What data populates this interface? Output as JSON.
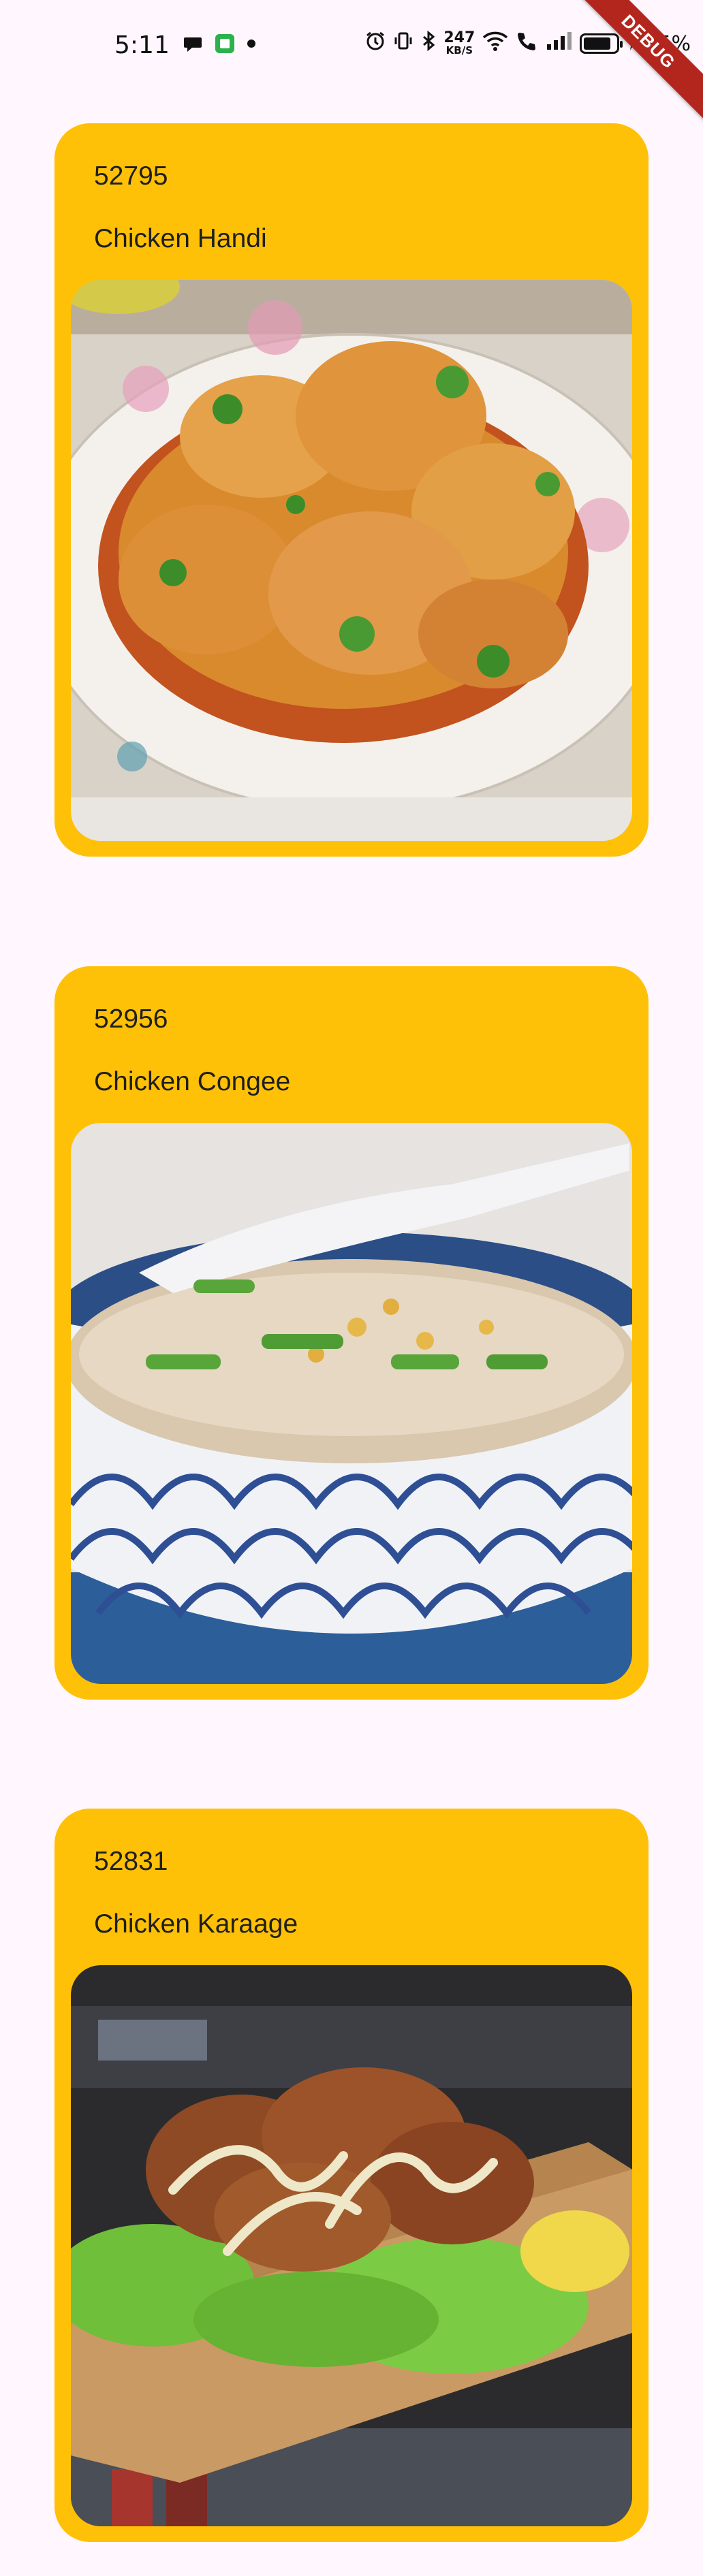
{
  "status_bar": {
    "time": "5:11",
    "net_speed": "247",
    "net_speed_unit": "KB/S",
    "battery_percent": "85%",
    "battery_level": 0.85
  },
  "debug_banner": "DEBUG",
  "meals": [
    {
      "id": "52795",
      "name": "Chicken Handi",
      "image": "chicken-handi-photo"
    },
    {
      "id": "52956",
      "name": "Chicken Congee",
      "image": "chicken-congee-photo"
    },
    {
      "id": "52831",
      "name": "Chicken Karaage",
      "image": "chicken-karaage-photo"
    }
  ],
  "colors": {
    "background": "#FFF7FD",
    "card": "#FFC107",
    "text": "#1F1F1F",
    "debug_banner": "#B3261E"
  }
}
